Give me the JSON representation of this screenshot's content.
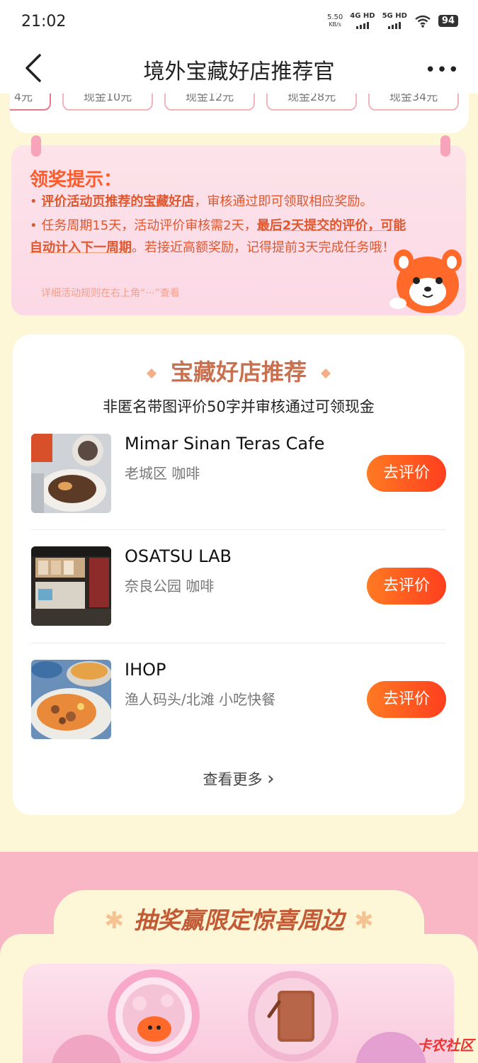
{
  "status": {
    "time": "21:02",
    "speed_value": "5.50",
    "speed_unit": "KB/s",
    "net1": "4G HD",
    "net2": "5G HD",
    "battery": "94"
  },
  "header": {
    "title": "境外宝藏好店推荐官",
    "more": "•••"
  },
  "cash_options": [
    "4元",
    "现金10元",
    "现金12元",
    "现金28元",
    "现金34元"
  ],
  "tips": {
    "title": "领奖提示：",
    "line1_em": "评价活动页推荐的宝藏好店",
    "line1_rest": "，审核通过即可领取相应奖励。",
    "line2_start": "任务周期15天，活动评价审核需2天，",
    "line2_em": "最后2天提交的评价，可能自动计入下一周期",
    "line2_rest": "。若接近高额奖励，记得提前3天完成任务哦！",
    "note": "详细活动规则在右上角“···”查看"
  },
  "shops": {
    "title": "宝藏好店推荐",
    "subtitle": "非匿名带图评价50字并审核通过可领现金",
    "items": [
      {
        "name": "Mimar Sinan Teras Cafe",
        "meta": "老城区 咖啡",
        "button": "去评价"
      },
      {
        "name": "OSATSU LAB",
        "meta": "奈良公园 咖啡",
        "button": "去评价"
      },
      {
        "name": "IHOP",
        "meta": "渔人码头/北滩 小吃快餐",
        "button": "去评价"
      }
    ],
    "see_more": "查看更多",
    "see_more_arrow": "›"
  },
  "lottery": {
    "title": "抽奖赢限定惊喜周边",
    "star": "✱"
  },
  "watermark": "卡农社区"
}
